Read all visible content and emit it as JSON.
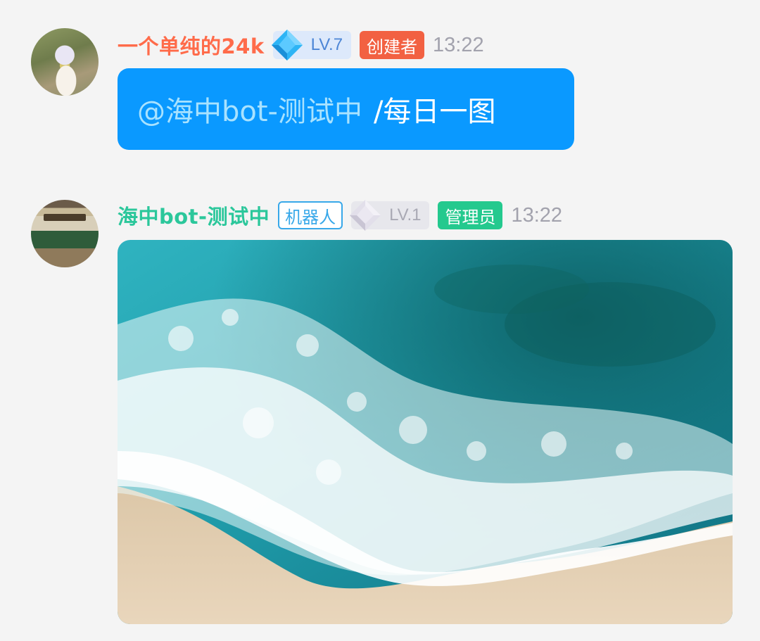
{
  "messages": [
    {
      "sender": "一个单纯的24k",
      "level": "LV.7",
      "role": "创建者",
      "time": "13:22",
      "mention": "@海中bot-测试中",
      "command": "/每日一图",
      "name_color": "#ff6b4a",
      "bubble_color": "#0a99ff"
    },
    {
      "sender": "海中bot-测试中",
      "bot_tag": "机器人",
      "level": "LV.1",
      "role": "管理员",
      "time": "13:22",
      "name_color": "#2bc79b",
      "image": "ocean-waves-beach-photo"
    }
  ]
}
